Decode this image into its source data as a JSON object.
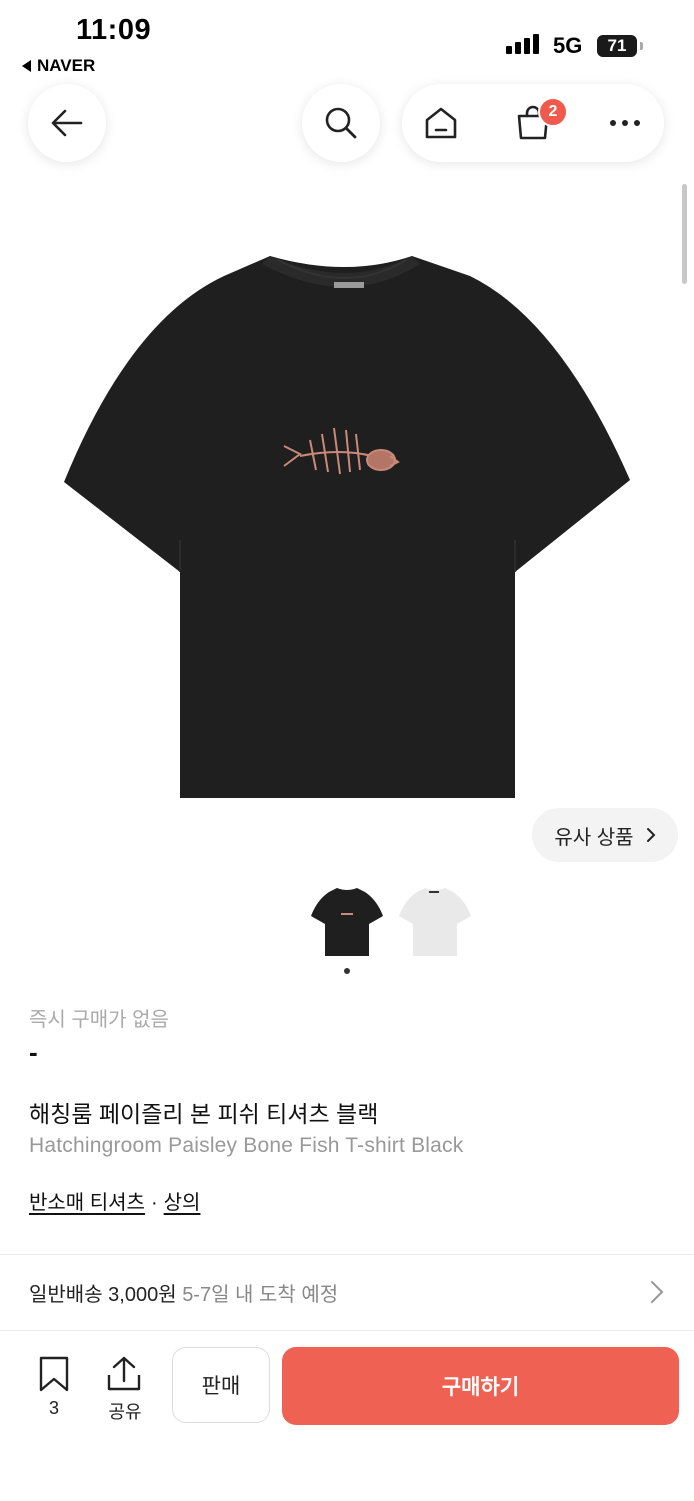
{
  "status_bar": {
    "time": "11:09",
    "back_app": "NAVER",
    "network": "5G",
    "battery": "71"
  },
  "header": {
    "cart_count": "2"
  },
  "gallery": {
    "similar_label": "유사 상품",
    "thumbnails": [
      "black",
      "white"
    ],
    "active_index": 0
  },
  "product": {
    "availability": "즉시 구매가 없음",
    "price": "-",
    "name_ko": "해칭룸 페이즐리 본 피쉬 티셔츠 블랙",
    "name_en": "Hatchingroom Paisley Bone Fish T-shirt Black",
    "category_1": "반소매 티셔츠",
    "category_sep": "·",
    "category_2": "상의"
  },
  "shipping": {
    "type": "일반배송",
    "fee": "3,000원",
    "eta": "5-7일 내 도착 예정"
  },
  "bottom_bar": {
    "bookmark_count": "3",
    "share_label": "공유",
    "sell_label": "판매",
    "buy_label": "구매하기"
  },
  "colors": {
    "accent": "#ef6253",
    "badge": "#ef5a4c",
    "shirt_black": "#1f1f1f",
    "print": "#c98a7a"
  }
}
